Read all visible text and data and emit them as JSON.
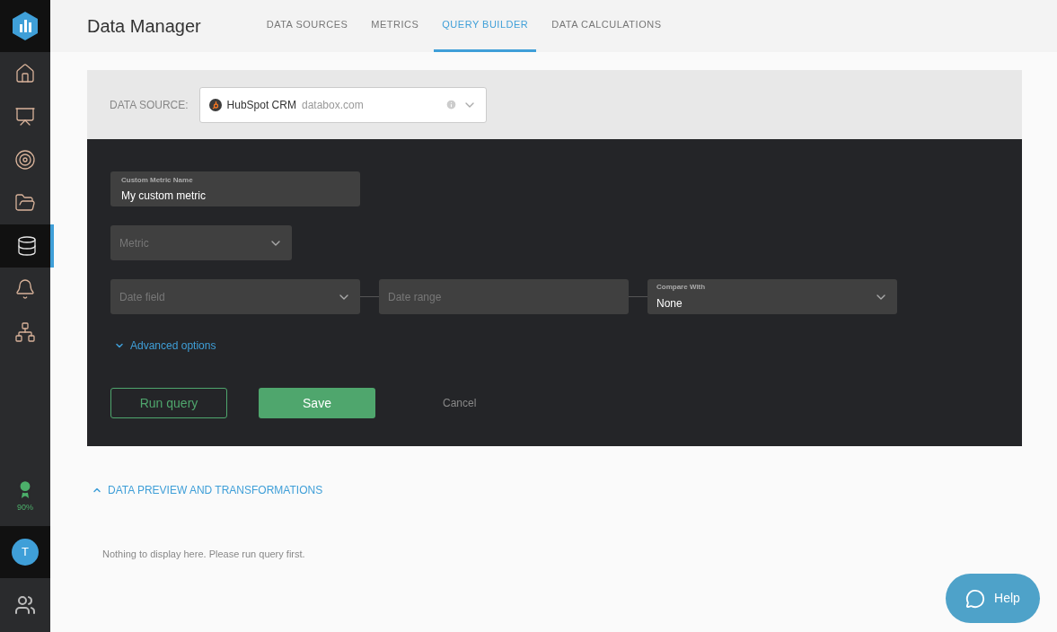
{
  "sidebar": {
    "items": [
      {
        "selected": false
      },
      {
        "selected": false
      },
      {
        "selected": false
      },
      {
        "selected": false
      },
      {
        "selected": true
      },
      {
        "selected": false
      },
      {
        "selected": false
      }
    ],
    "achievement": "90%",
    "avatar": "T"
  },
  "header": {
    "title": "Data Manager",
    "tabs": [
      {
        "label": "DATA SOURCES",
        "selected": false
      },
      {
        "label": "METRICS",
        "selected": false
      },
      {
        "label": "QUERY BUILDER",
        "selected": true
      },
      {
        "label": "DATA CALCULATIONS",
        "selected": false
      }
    ]
  },
  "data_source": {
    "label": "DATA SOURCE:",
    "name": "HubSpot CRM",
    "domain": "databox.com"
  },
  "form": {
    "metric_name": {
      "label": "Custom Metric Name",
      "value": "My custom metric"
    },
    "metric": {
      "placeholder": "Metric"
    },
    "date_field": {
      "placeholder": "Date field"
    },
    "date_range": {
      "placeholder": "Date range"
    },
    "compare_with": {
      "label": "Compare With",
      "value": "None"
    },
    "advanced_options": {
      "label": "Advanced options",
      "expanded": false
    },
    "buttons": {
      "run": "Run query",
      "save": "Save",
      "cancel": "Cancel"
    }
  },
  "preview": {
    "title": "DATA PREVIEW AND TRANSFORMATIONS",
    "expanded": true,
    "message": "Nothing to display here. Please run query first."
  },
  "help_button": "Help"
}
